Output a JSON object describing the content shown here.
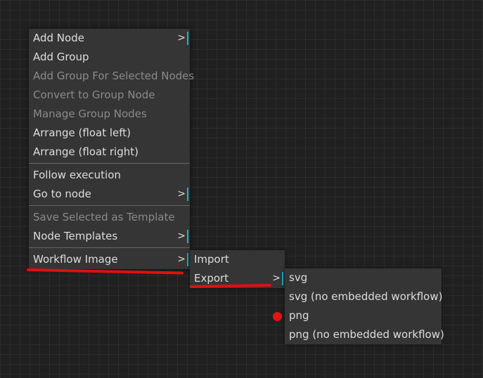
{
  "main_menu": {
    "items": [
      {
        "label": "Add Node",
        "arrow": ">"
      },
      {
        "label": "Add Group"
      },
      {
        "label": "Add Group For Selected Nodes"
      },
      {
        "label": "Convert to Group Node"
      },
      {
        "label": "Manage Group Nodes"
      },
      {
        "label": "Arrange (float left)"
      },
      {
        "label": "Arrange (float right)"
      },
      {
        "label": "Follow execution"
      },
      {
        "label": "Go to node",
        "arrow": ">"
      },
      {
        "label": "Save Selected as Template"
      },
      {
        "label": "Node Templates",
        "arrow": ">"
      },
      {
        "label": "Workflow Image",
        "arrow": ">"
      }
    ]
  },
  "workflow_image_menu": {
    "items": [
      {
        "label": "Import"
      },
      {
        "label": "Export",
        "arrow": ">"
      }
    ]
  },
  "export_menu": {
    "items": [
      {
        "label": "svg"
      },
      {
        "label": "svg (no embedded workflow)"
      },
      {
        "label": "png"
      },
      {
        "label": "png (no embedded workflow)"
      }
    ]
  },
  "colors": {
    "accent": "#17b3c9",
    "annotation": "#e01010"
  }
}
